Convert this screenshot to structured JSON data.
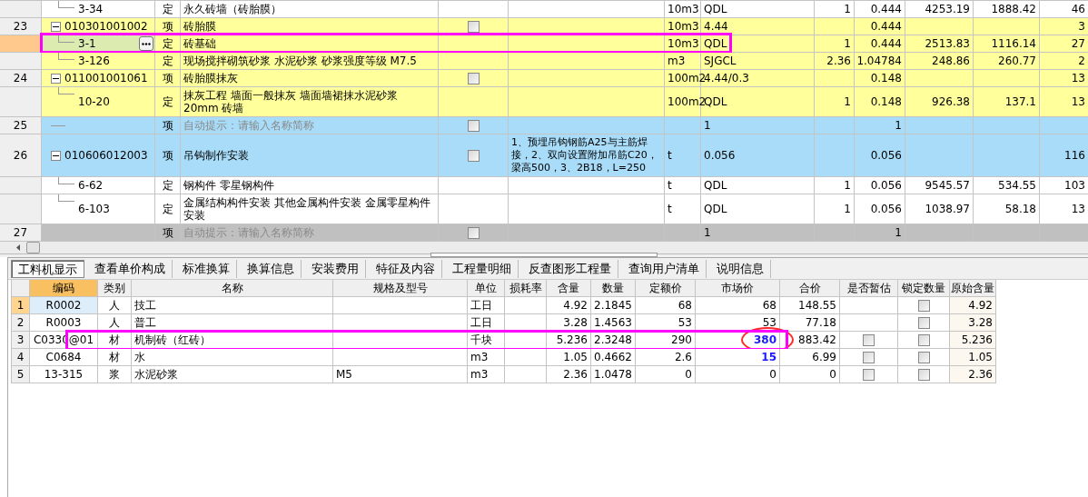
{
  "top_grid": {
    "rows": [
      {
        "kind": "quota",
        "code": "3-34",
        "type": "定",
        "name": "永久砖墙（砖胎膜）",
        "unit": "10m3",
        "expr": "QDL",
        "content": "1",
        "qty": "0.444",
        "price": "4253.19",
        "sum": "1888.42",
        "cut": "46",
        "color": "#ffffff",
        "selected": false
      },
      {
        "num": "23",
        "kind": "item",
        "expanded": true,
        "code": "010301001002",
        "type": "项",
        "name": "砖胎膜",
        "checked": false,
        "unit": "10m3",
        "expr": "4.44",
        "qty": "0.444",
        "cut": "3",
        "color": "#ffff9c",
        "selected": false
      },
      {
        "kind": "quota",
        "code": "3-1",
        "type": "定",
        "name": "砖基础",
        "unit": "10m3",
        "expr": "QDL",
        "content": "1",
        "qty": "0.444",
        "price": "2513.83",
        "sum": "1116.14",
        "cut": "27",
        "color": "#ffff9c",
        "selected": true,
        "highlighted": true
      },
      {
        "kind": "quota",
        "code": "3-126",
        "type": "定",
        "name": "现场搅拌砌筑砂浆 水泥砂浆 砂浆强度等级 M7.5",
        "unit": "m3",
        "expr": "SJGCL",
        "content": "2.36",
        "qty": "1.04784",
        "price": "248.86",
        "sum": "260.77",
        "cut": "2",
        "color": "#ffff9c",
        "selected": false
      },
      {
        "num": "24",
        "kind": "item",
        "expanded": true,
        "code": "011001001061",
        "type": "项",
        "name": "砖胎膜抹灰",
        "checked": false,
        "unit": "100m2",
        "expr": "4.44/0.3",
        "qty": "0.148",
        "cut": "13",
        "color": "#ffff9c",
        "selected": false
      },
      {
        "kind": "quota",
        "code": "10-20",
        "type": "定",
        "name": "抹灰工程 墙面一般抹灰 墙面墙裙抹水泥砂浆 20mm 砖墙",
        "unit": "100m2",
        "expr": "QDL",
        "content": "1",
        "qty": "0.148",
        "price": "926.38",
        "sum": "137.1",
        "cut": "13",
        "color": "#ffff9c",
        "selected": false
      },
      {
        "num": "25",
        "kind": "item",
        "type": "项",
        "name": "自动提示：请输入名称简称",
        "hint": true,
        "checked": false,
        "expr": "1",
        "qty": "1",
        "color": "#a8dcf8",
        "selected": false
      },
      {
        "num": "26",
        "kind": "item",
        "expanded": true,
        "code": "010606012003",
        "type": "项",
        "name": "吊钩制作安装",
        "checked": false,
        "feature": "1、预埋吊钩钢筋A25与主筋焊接，2、双向设置附加吊筋C20，梁高500，3、2B18，L=250",
        "unit": "t",
        "expr": "0.056",
        "qty": "0.056",
        "cut": "116",
        "color": "#a8dcf8",
        "selected": false
      },
      {
        "kind": "quota",
        "code": "6-62",
        "type": "定",
        "name": "钢构件 零星钢构件",
        "unit": "t",
        "expr": "QDL",
        "content": "1",
        "qty": "0.056",
        "price": "9545.57",
        "sum": "534.55",
        "cut": "103",
        "color": "#ffffff",
        "selected": false
      },
      {
        "kind": "quota",
        "code": "6-103",
        "type": "定",
        "name": "金属结构构件安装 其他金属构件安装 金属零星构件安装",
        "unit": "t",
        "expr": "QDL",
        "content": "1",
        "qty": "0.056",
        "price": "1038.97",
        "sum": "58.18",
        "cut": "13",
        "color": "#ffffff",
        "selected": false
      },
      {
        "num": "27",
        "kind": "blank",
        "type": "项",
        "name": "自动提示：请输入名称简称",
        "hint": true,
        "checked": false,
        "expr": "1",
        "qty": "1",
        "color": "#c0c0c0",
        "selected": false
      }
    ]
  },
  "tabs": [
    {
      "label": "工料机显示",
      "selected": true
    },
    {
      "label": "查看单价构成",
      "selected": false
    },
    {
      "label": "标准换算",
      "selected": false
    },
    {
      "label": "换算信息",
      "selected": false
    },
    {
      "label": "安装费用",
      "selected": false
    },
    {
      "label": "特征及内容",
      "selected": false
    },
    {
      "label": "工程量明细",
      "selected": false
    },
    {
      "label": "反查图形工程量",
      "selected": false
    },
    {
      "label": "查询用户清单",
      "selected": false
    },
    {
      "label": "说明信息",
      "selected": false
    }
  ],
  "resource_table": {
    "columns": [
      {
        "label": "编码",
        "selected": true
      },
      {
        "label": "类别",
        "selected": false
      },
      {
        "label": "名称",
        "selected": false
      },
      {
        "label": "规格及型号",
        "selected": false
      },
      {
        "label": "单位",
        "selected": false
      },
      {
        "label": "损耗率",
        "selected": false
      },
      {
        "label": "含量",
        "selected": false
      },
      {
        "label": "数量",
        "selected": false
      },
      {
        "label": "定额价",
        "selected": false
      },
      {
        "label": "市场价",
        "selected": false
      },
      {
        "label": "合价",
        "selected": false
      },
      {
        "label": "是否暂估",
        "selected": false
      },
      {
        "label": "锁定数量",
        "selected": false
      },
      {
        "label": "原始含量",
        "selected": false
      }
    ],
    "rows": [
      {
        "num": "1",
        "code": "R0002",
        "cat": "人",
        "name": "技工",
        "unit": "工日",
        "content": "4.92",
        "qty": "2.1845",
        "quota_price": "68",
        "market_price": "68",
        "modified": false,
        "total": "148.55",
        "locked": false,
        "orig": "4.92",
        "selected": true
      },
      {
        "num": "2",
        "code": "R0003",
        "cat": "人",
        "name": "普工",
        "unit": "工日",
        "content": "3.28",
        "qty": "1.4563",
        "quota_price": "53",
        "market_price": "53",
        "modified": false,
        "total": "77.18",
        "locked": false,
        "orig": "3.28",
        "selected": false
      },
      {
        "num": "3",
        "code": "C0330@01",
        "cat": "材",
        "name": "机制砖（红砖）",
        "unit": "千块",
        "content": "5.236",
        "qty": "2.3248",
        "quota_price": "290",
        "market_price": "380",
        "modified": true,
        "total": "883.42",
        "provisional": false,
        "locked": false,
        "orig": "5.236",
        "selected": false,
        "highlighted": true
      },
      {
        "num": "4",
        "code": "C0684",
        "cat": "材",
        "name": "水",
        "unit": "m3",
        "content": "1.05",
        "qty": "0.4662",
        "quota_price": "2.6",
        "market_price": "15",
        "modified": true,
        "total": "6.99",
        "provisional": false,
        "locked": false,
        "orig": "1.05",
        "selected": false
      },
      {
        "num": "5",
        "code": "13-315",
        "cat": "浆",
        "name": "水泥砂浆",
        "spec": "M5",
        "unit": "m3",
        "content": "2.36",
        "qty": "1.0478",
        "quota_price": "0",
        "market_price": "0",
        "modified": false,
        "total": "0",
        "provisional": false,
        "locked": false,
        "orig": "2.36",
        "selected": false
      }
    ]
  }
}
